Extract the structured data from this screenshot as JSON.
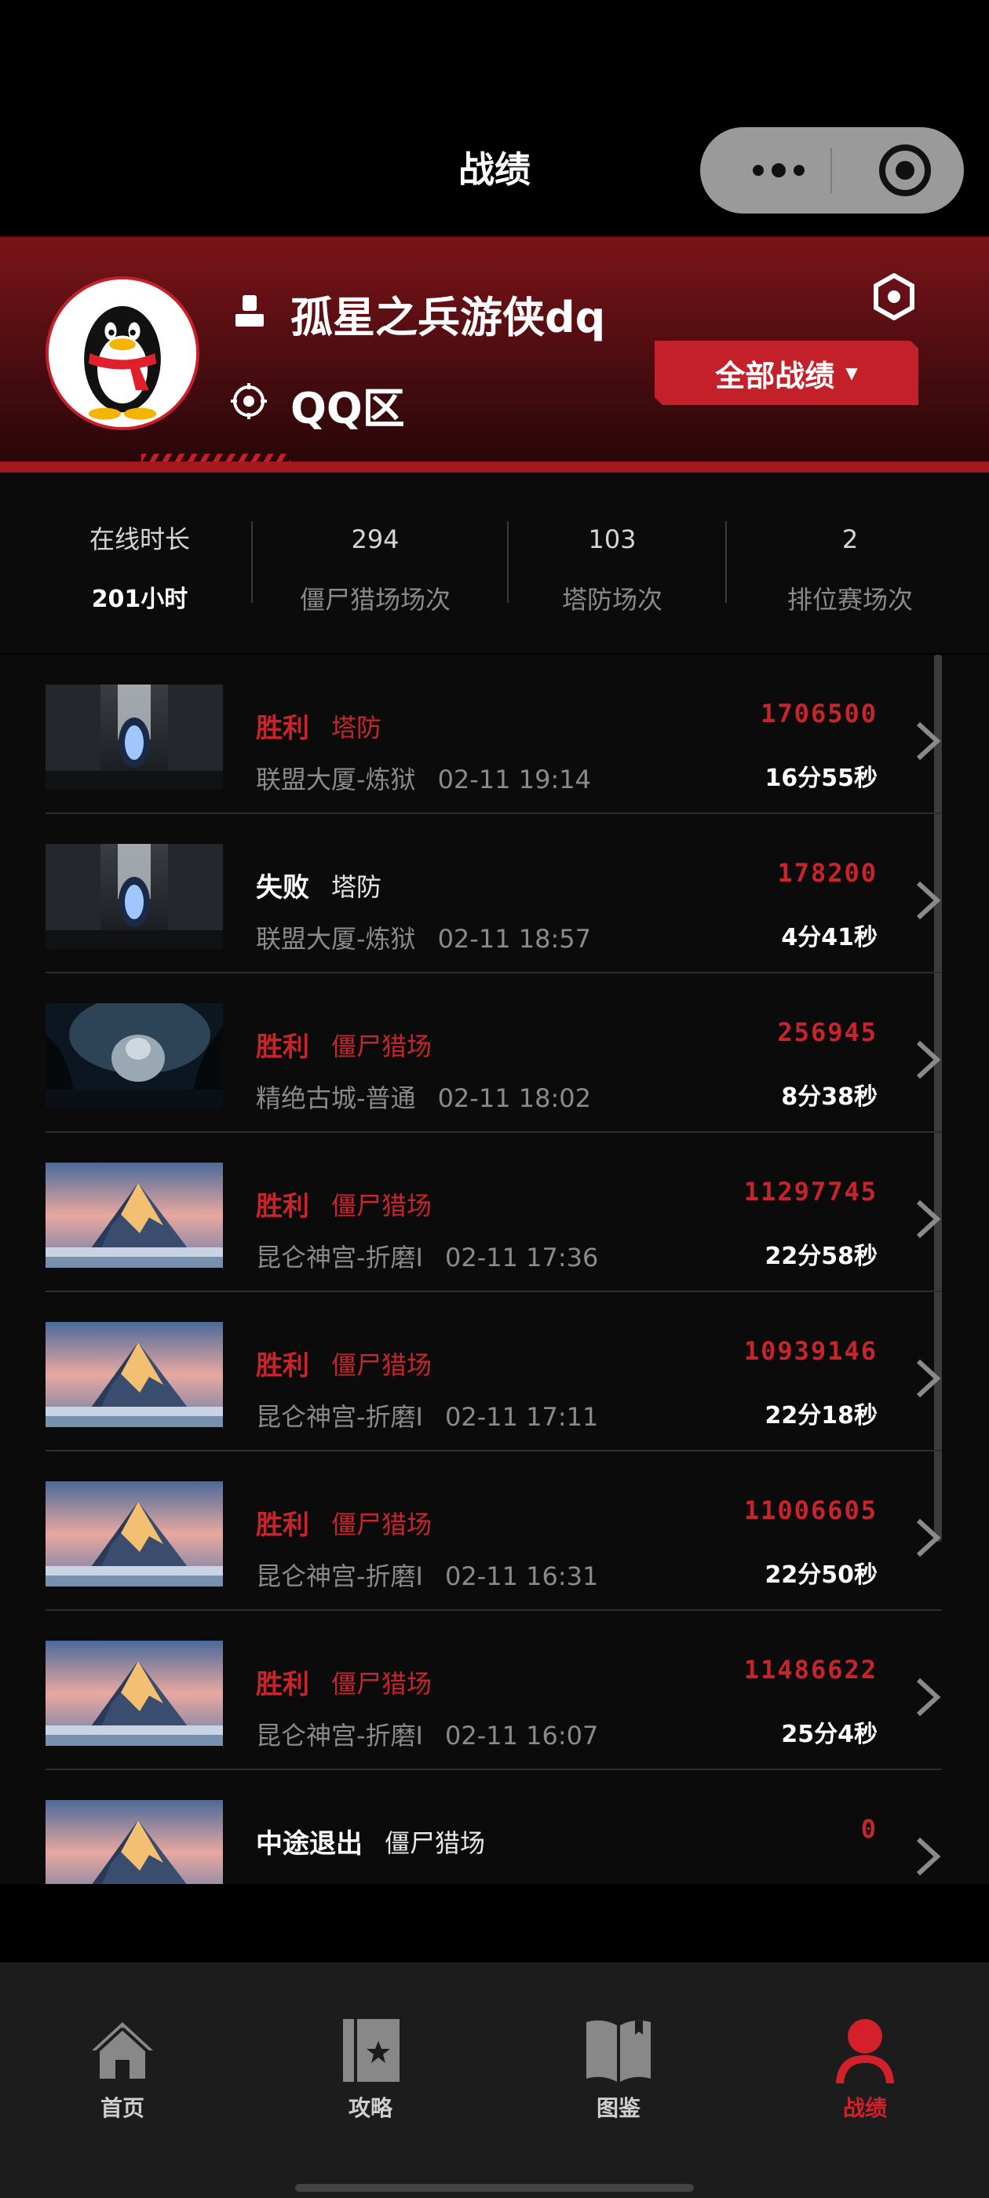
{
  "header": {
    "title": "战绩"
  },
  "profile": {
    "username": "孤星之兵游侠dq",
    "zone": "QQ区",
    "filter_label": "全部战绩",
    "filter_caret": "▼"
  },
  "stats": [
    {
      "value": "在线时长",
      "label": "201小时"
    },
    {
      "value": "294",
      "label": "僵尸猎场场次"
    },
    {
      "value": "103",
      "label": "塔防场次"
    },
    {
      "value": "2",
      "label": "排位赛场次"
    }
  ],
  "matches": [
    {
      "result": "胜利",
      "mode": "塔防",
      "map": "联盟大厦-炼狱",
      "time": "02-11 19:14",
      "score": "1706500",
      "duration": "16分55秒",
      "thumb": "tower"
    },
    {
      "result": "失败",
      "mode": "塔防",
      "map": "联盟大厦-炼狱",
      "time": "02-11 18:57",
      "score": "178200",
      "duration": "4分41秒",
      "thumb": "tower"
    },
    {
      "result": "胜利",
      "mode": "僵尸猎场",
      "map": "精绝古城-普通",
      "time": "02-11 18:02",
      "score": "256945",
      "duration": "8分38秒",
      "thumb": "cave"
    },
    {
      "result": "胜利",
      "mode": "僵尸猎场",
      "map": "昆仑神宫-折磨I",
      "time": "02-11 17:36",
      "score": "11297745",
      "duration": "22分58秒",
      "thumb": "mountain"
    },
    {
      "result": "胜利",
      "mode": "僵尸猎场",
      "map": "昆仑神宫-折磨I",
      "time": "02-11 17:11",
      "score": "10939146",
      "duration": "22分18秒",
      "thumb": "mountain"
    },
    {
      "result": "胜利",
      "mode": "僵尸猎场",
      "map": "昆仑神宫-折磨I",
      "time": "02-11 16:31",
      "score": "11006605",
      "duration": "22分50秒",
      "thumb": "mountain"
    },
    {
      "result": "胜利",
      "mode": "僵尸猎场",
      "map": "昆仑神宫-折磨I",
      "time": "02-11 16:07",
      "score": "11486622",
      "duration": "25分4秒",
      "thumb": "mountain"
    },
    {
      "result": "中途退出",
      "mode": "僵尸猎场",
      "map": "",
      "time": "",
      "score": "0",
      "duration": "",
      "thumb": "mountain"
    }
  ],
  "tabs": [
    {
      "label": "首页",
      "icon": "home-icon"
    },
    {
      "label": "攻略",
      "icon": "guide-book-icon"
    },
    {
      "label": "图鉴",
      "icon": "open-book-icon"
    },
    {
      "label": "战绩",
      "icon": "person-icon"
    }
  ],
  "colors": {
    "accent": "#c8242c",
    "background": "#0b0b0b"
  }
}
